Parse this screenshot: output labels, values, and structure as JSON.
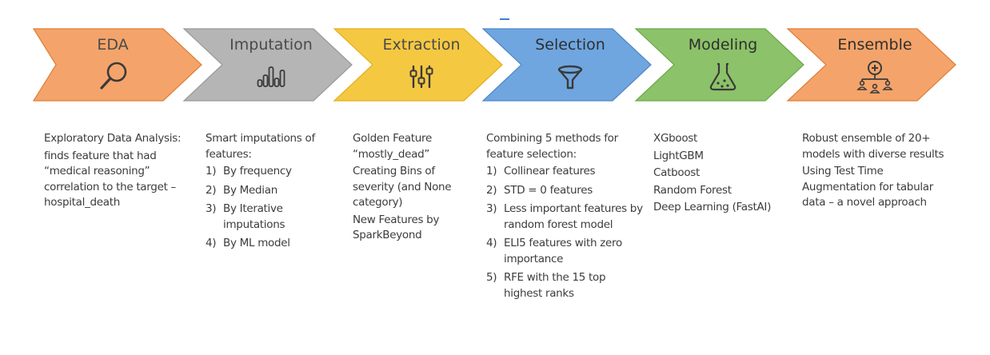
{
  "stages": [
    {
      "id": "eda",
      "title": "EDA",
      "icon": "magnifier-icon",
      "fill": "#F4A46A",
      "stroke": "#E07D36",
      "title_color": "#4a4a4a"
    },
    {
      "id": "imputation",
      "title": "Imputation",
      "icon": "bar-chart-icon",
      "fill": "#B5B5B5",
      "stroke": "#999999",
      "title_color": "#4a4a4a"
    },
    {
      "id": "extraction",
      "title": "Extraction",
      "icon": "sliders-icon",
      "fill": "#F5C842",
      "stroke": "#E3AE18",
      "title_color": "#4a4a4a"
    },
    {
      "id": "selection",
      "title": "Selection",
      "icon": "funnel-icon",
      "fill": "#6FA6E0",
      "stroke": "#4F86C6",
      "title_color": "#2f2f2f"
    },
    {
      "id": "modeling",
      "title": "Modeling",
      "icon": "flask-icon",
      "fill": "#8CC269",
      "stroke": "#6EA84A",
      "title_color": "#2f2f2f"
    },
    {
      "id": "ensemble",
      "title": "Ensemble",
      "icon": "network-icon",
      "fill": "#F4A46A",
      "stroke": "#E07D36",
      "title_color": "#2f2f2f"
    }
  ],
  "columns": {
    "eda": {
      "paragraphs": [
        "Exploratory Data Analysis:",
        "finds feature that had “medical reasoning” correlation to the target – hospital_death"
      ],
      "items": []
    },
    "imputation": {
      "paragraphs": [
        "Smart imputations of features:"
      ],
      "items": [
        {
          "num": "1)",
          "text": "By frequency"
        },
        {
          "num": "2)",
          "text": "By Median"
        },
        {
          "num": "3)",
          "text": "By Iterative imputations"
        },
        {
          "num": "4)",
          "text": "By ML model"
        }
      ]
    },
    "extraction": {
      "paragraphs": [
        "Golden Feature “mostly_dead”",
        "Creating Bins of severity (and None category)",
        "New Features by SparkBeyond"
      ],
      "items": []
    },
    "selection": {
      "paragraphs": [
        "Combining 5 methods for feature selection:"
      ],
      "items": [
        {
          "num": "1)",
          "text": "Collinear features"
        },
        {
          "num": "2)",
          "text": "STD = 0 features"
        },
        {
          "num": "3)",
          "text": "Less important features by random forest model"
        },
        {
          "num": "4)",
          "text": "ELI5 features with zero importance"
        },
        {
          "num": "5)",
          "text": "RFE with the 15 top highest ranks"
        }
      ]
    },
    "modeling": {
      "paragraphs": [
        "XGboost",
        "LightGBM",
        "Catboost",
        "Random Forest",
        "Deep Learning (FastAI)"
      ],
      "items": []
    },
    "ensemble": {
      "paragraphs": [
        "Robust ensemble of 20+ models with diverse results",
        "Using Test Time Augmentation for tabular data – a novel approach"
      ],
      "items": []
    }
  }
}
